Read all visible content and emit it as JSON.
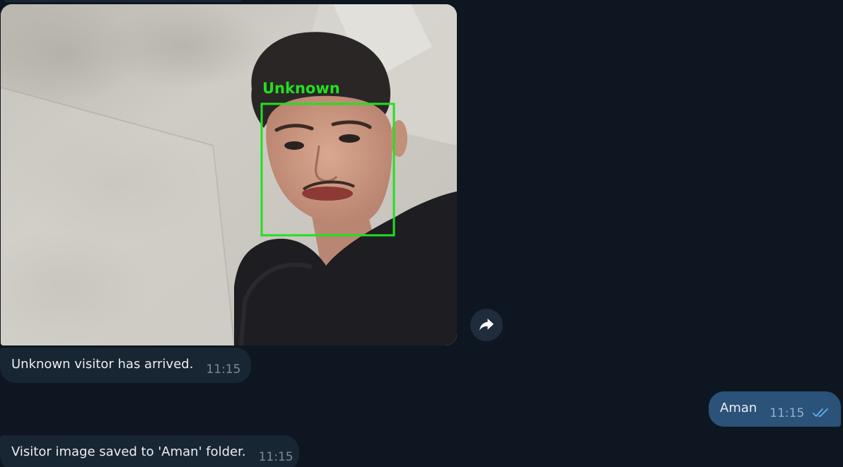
{
  "photo": {
    "face_label": "Unknown",
    "box_color": "#22e01f"
  },
  "messages": [
    {
      "id": "visitor",
      "direction": "incoming",
      "text": "Unknown visitor has arrived.",
      "time": "11:15"
    },
    {
      "id": "aman",
      "direction": "outgoing",
      "text": "Aman",
      "time": "11:15",
      "status": "read"
    },
    {
      "id": "saved",
      "direction": "incoming",
      "text": "Visitor image saved to 'Aman' folder.",
      "time": "11:15"
    }
  ],
  "icons": {
    "forward": "forward-arrow-icon",
    "read_status": "double-check-icon"
  },
  "colors": {
    "background": "#0e1621",
    "incoming_bubble": "#182533",
    "outgoing_bubble": "#2b5278",
    "read_ticks": "#5fb0ee"
  }
}
